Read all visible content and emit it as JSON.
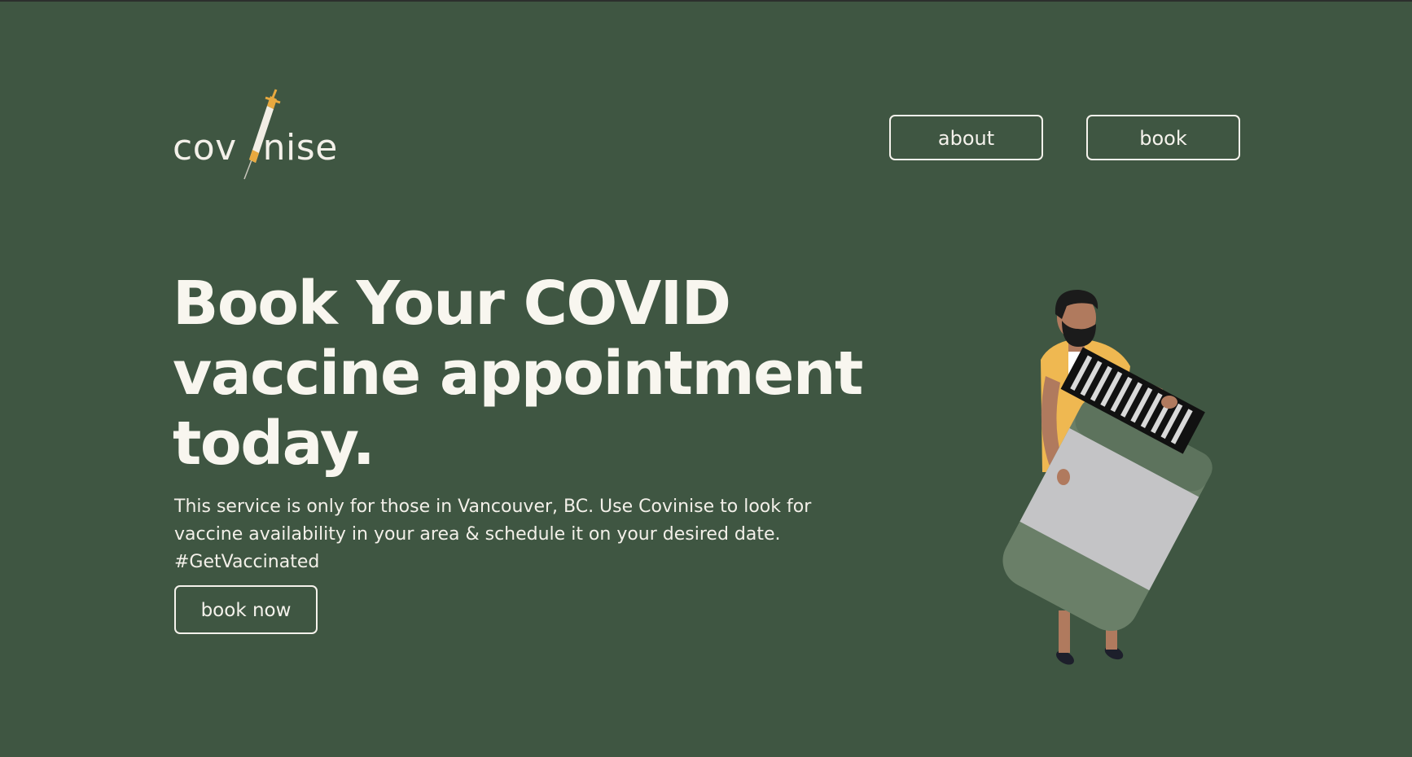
{
  "brand": {
    "logo_left": "cov",
    "logo_right": "nise",
    "colors": {
      "background": "#3f5642",
      "text": "#f8f6ef",
      "syringe_orange": "#e8a93f"
    }
  },
  "nav": {
    "about_label": "about",
    "book_label": "book"
  },
  "hero": {
    "title": "Book Your COVID vaccine appointment today.",
    "description": "This service is only for those in Vancouver, BC. Use Covinise to look for vaccine availability in your area & schedule it on your desired date. #GetVaccinated",
    "cta_label": "book now"
  },
  "illustration": {
    "icon": "person-holding-vaccine-vial-icon"
  }
}
